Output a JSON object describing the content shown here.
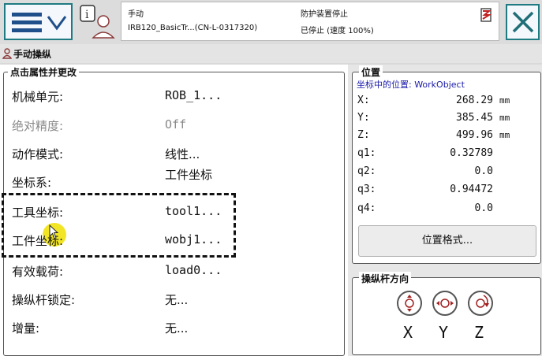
{
  "header": {
    "status_col1_line1": "手动",
    "status_col1_line2": "IRB120_BasicTr...(CN-L-0317320)",
    "status_col2_line1": "防护装置停止",
    "status_col2_line2": "已停止 (速度 100%)"
  },
  "tab": {
    "label": "手动操纵"
  },
  "properties": {
    "group_title": "点击属性并更改",
    "rows": [
      {
        "label": "机械单元:",
        "value": "ROB_1...",
        "enabled": true
      },
      {
        "label": "绝对精度:",
        "value": "Off",
        "enabled": false
      },
      {
        "label": "动作模式:",
        "value": "线性...",
        "enabled": true
      },
      {
        "label": "坐标系:",
        "value": "工件坐标",
        "enabled": true
      },
      {
        "label": "工具坐标:",
        "value": "tool1...",
        "enabled": true
      },
      {
        "label": "工件坐标:",
        "value": "wobj1...",
        "enabled": true
      },
      {
        "label": "有效载荷:",
        "value": "load0...",
        "enabled": true
      },
      {
        "label": "操纵杆锁定:",
        "value": "无...",
        "enabled": true
      },
      {
        "label": "增量:",
        "value": "无...",
        "enabled": true
      }
    ]
  },
  "position": {
    "group_title": "位置",
    "subtitle": "坐标中的位置: WorkObject",
    "rows": [
      {
        "label": "X:",
        "value": "268.29",
        "unit": "mm"
      },
      {
        "label": "Y:",
        "value": "385.45",
        "unit": "mm"
      },
      {
        "label": "Z:",
        "value": "499.96",
        "unit": "mm"
      },
      {
        "label": "q1:",
        "value": "0.32789",
        "unit": ""
      },
      {
        "label": "q2:",
        "value": "0.0",
        "unit": ""
      },
      {
        "label": "q3:",
        "value": "0.94472",
        "unit": ""
      },
      {
        "label": "q4:",
        "value": "0.0",
        "unit": ""
      }
    ],
    "format_button": "位置格式..."
  },
  "joystick": {
    "group_title": "操纵杆方向",
    "axes": [
      "X",
      "Y",
      "Z"
    ]
  },
  "colors": {
    "accent": "#1f7a82",
    "highlight": "#f0e000",
    "subtitle": "#1a1aa8"
  }
}
